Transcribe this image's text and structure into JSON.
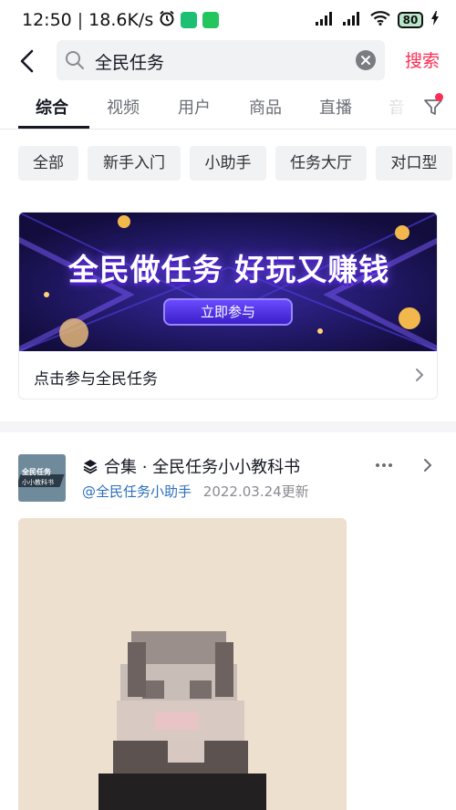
{
  "status_bar": {
    "time": "12:50",
    "net_speed": "18.6K/s",
    "battery": "80"
  },
  "search": {
    "query": "全民任务",
    "submit_label": "搜索"
  },
  "tabs": [
    {
      "label": "综合",
      "active": true
    },
    {
      "label": "视频"
    },
    {
      "label": "用户"
    },
    {
      "label": "商品"
    },
    {
      "label": "直播"
    },
    {
      "label": "音"
    }
  ],
  "chips": [
    "全部",
    "新手入门",
    "小助手",
    "任务大厅",
    "对口型"
  ],
  "banner": {
    "headline": "全民做任务 好玩又赚钱",
    "cta": "立即参与",
    "footer_label": "点击参与全民任务"
  },
  "collection": {
    "title": "合集 · 全民任务小小教科书",
    "author": "@全民任务小助手",
    "updated": "2022.03.24更新",
    "thumb_line1": "全民任务",
    "thumb_line2": "小小教科书"
  },
  "colors": {
    "accent": "#fe2c55",
    "link": "#2c6fbd",
    "banner_bg": "#1a1550"
  }
}
